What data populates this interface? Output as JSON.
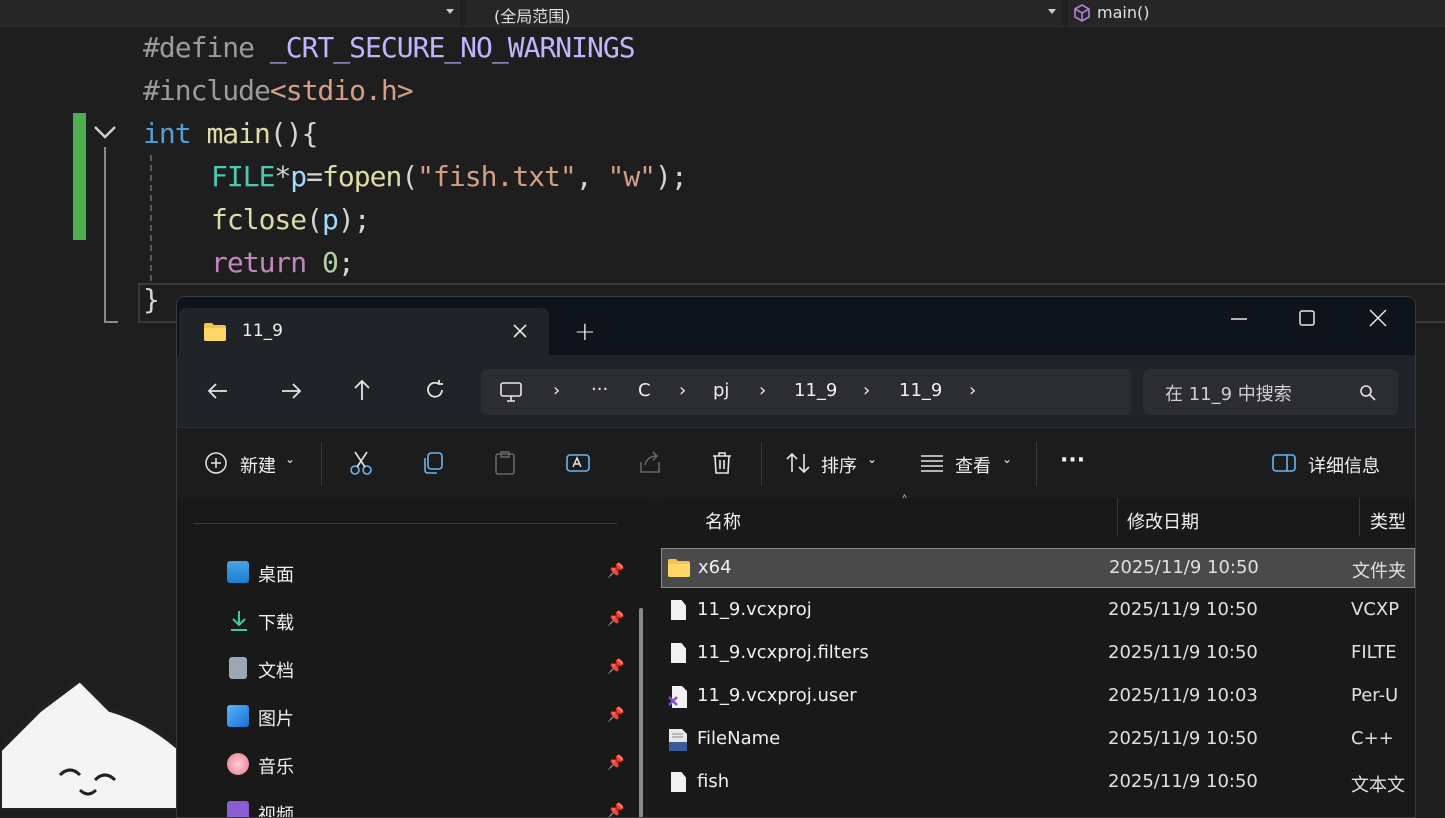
{
  "vs": {
    "scope_label": "(全局范围)",
    "member_label": "main()",
    "code": {
      "line1": [
        "#define",
        " ",
        "_CRT_SECURE_NO_WARNINGS"
      ],
      "line2": [
        "#include",
        "<stdio.h>"
      ],
      "line3": [
        "int",
        " ",
        "main",
        "(){"
      ],
      "line4": [
        "FILE",
        "*",
        "p",
        "=",
        "fopen",
        "(",
        "\"fish.txt\"",
        ", ",
        "\"w\"",
        ");"
      ],
      "line5": [
        "fclose",
        "(",
        "p",
        ");"
      ],
      "line6": [
        "return",
        " ",
        "0",
        ";"
      ],
      "line7": "}"
    }
  },
  "explorer": {
    "tab_title": "11_9",
    "new_tab": "+",
    "breadcrumb": [
      "C",
      "pj",
      "11_9",
      "11_9"
    ],
    "breadcrumb_more": "···",
    "search_placeholder": "在 11_9 中搜索",
    "toolbar": {
      "new_label": "新建",
      "sort_label": "排序",
      "view_label": "查看",
      "more_label": "···",
      "details_label": "详细信息"
    },
    "columns": {
      "name": "名称",
      "date": "修改日期",
      "type": "类型"
    },
    "sidebar": [
      {
        "label": "桌面"
      },
      {
        "label": "下载"
      },
      {
        "label": "文档"
      },
      {
        "label": "图片"
      },
      {
        "label": "音乐"
      },
      {
        "label": "视频"
      }
    ],
    "files": [
      {
        "name": "x64",
        "date": "2025/11/9 10:50",
        "type": "文件夹"
      },
      {
        "name": "11_9.vcxproj",
        "date": "2025/11/9 10:50",
        "type": "VCXP"
      },
      {
        "name": "11_9.vcxproj.filters",
        "date": "2025/11/9 10:50",
        "type": "FILTE"
      },
      {
        "name": "11_9.vcxproj.user",
        "date": "2025/11/9 10:03",
        "type": "Per-U"
      },
      {
        "name": "FileName",
        "date": "2025/11/9 10:50",
        "type": "C++"
      },
      {
        "name": "fish",
        "date": "2025/11/9 10:50",
        "type": "文本文"
      }
    ]
  },
  "colors": {
    "change_bar": "#4caf50",
    "folder": "#f5c24c",
    "selected_row": "#4a4a4a"
  }
}
